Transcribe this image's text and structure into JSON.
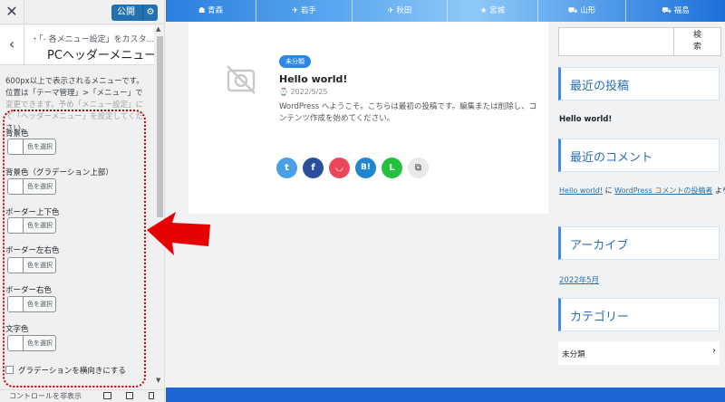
{
  "panel": {
    "close_icon": "✕",
    "publish_label": "公開",
    "publish_gear": "⚙",
    "back_icon": "‹",
    "breadcrumb": "・「- 各メニュー設定」をカスタ...",
    "section_title": "PCヘッダーメニュー",
    "description": "600px以上で表示されるメニューです。位置は「テーマ管理」>「メニュー」で変更できます。予め「メニュー設定」にて「ヘッダーメニュー」を設定してください。",
    "controls": [
      {
        "label": "背景色",
        "button": "色を選択"
      },
      {
        "label": "背景色（グラデーション上部）",
        "button": "色を選択"
      },
      {
        "label": "ボーダー上下色",
        "button": "色を選択"
      },
      {
        "label": "ボーダー左右色",
        "button": "色を選択"
      },
      {
        "label": "ボーダー右色",
        "button": "色を選択"
      },
      {
        "label": "文字色",
        "button": "色を選択"
      }
    ],
    "checkbox_label": "グラデーションを横向きにする",
    "footer_hide": "コントロールを非表示"
  },
  "preview": {
    "nav": [
      {
        "icon": "☗",
        "label": "青森"
      },
      {
        "icon": "✈",
        "label": "岩手"
      },
      {
        "icon": "✈",
        "label": "秋田"
      },
      {
        "icon": "★",
        "label": "宮城"
      },
      {
        "icon": "⛟",
        "label": "山形"
      },
      {
        "icon": "⛟",
        "label": "福島"
      }
    ],
    "post": {
      "category": "未分類",
      "title": "Hello world!",
      "date": "⌚ 2022/5/25",
      "excerpt": "WordPress へようこそ。こちらは最初の投稿です。編集または削除し、コンテンツ作成を始めてください。"
    },
    "share": [
      {
        "name": "twitter",
        "glyph": "t",
        "color": "#4a9fe6"
      },
      {
        "name": "facebook",
        "glyph": "f",
        "color": "#2b4f9a"
      },
      {
        "name": "pocket",
        "glyph": "◡",
        "color": "#e8485a"
      },
      {
        "name": "hatena",
        "glyph": "B!",
        "color": "#1f86cf"
      },
      {
        "name": "line",
        "glyph": "L",
        "color": "#23c13d"
      },
      {
        "name": "copy",
        "glyph": "⧉",
        "color": "#e9e9e9"
      }
    ],
    "sidebar": {
      "search_button": "検索",
      "recent_posts_heading": "最近の投稿",
      "recent_post_item": "Hello world!",
      "recent_comments_heading": "最近のコメント",
      "comment_post_link": "Hello world!",
      "comment_mid": " に ",
      "comment_author_link": "WordPress コメントの投稿者",
      "comment_tail": " より",
      "archives_heading": "アーカイブ",
      "archive_item": "2022年5月",
      "categories_heading": "カテゴリー",
      "category_item": "未分類",
      "category_chevron": "›"
    }
  }
}
